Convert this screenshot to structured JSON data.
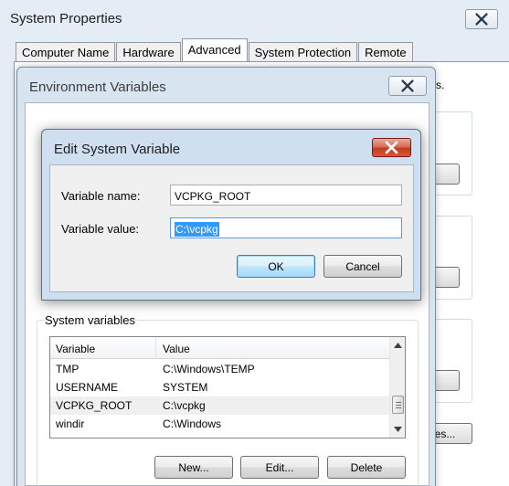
{
  "system_properties": {
    "title": "System Properties",
    "tabs": [
      {
        "label": "Computer Name"
      },
      {
        "label": "Hardware"
      },
      {
        "label": "Advanced"
      },
      {
        "label": "System Protection"
      },
      {
        "label": "Remote"
      }
    ],
    "active_tab": "Advanced",
    "edge_text": "s.",
    "edge_buttons": [
      "...",
      "...",
      "...",
      "les..."
    ]
  },
  "environment_variables": {
    "title": "Environment Variables",
    "system_vars_label": "System variables",
    "columns": [
      "Variable",
      "Value"
    ],
    "rows": [
      {
        "variable": "TMP",
        "value": "C:\\Windows\\TEMP"
      },
      {
        "variable": "USERNAME",
        "value": "SYSTEM"
      },
      {
        "variable": "VCPKG_ROOT",
        "value": "C:\\vcpkg"
      },
      {
        "variable": "windir",
        "value": "C:\\Windows"
      }
    ],
    "buttons": {
      "new": "New...",
      "edit": "Edit...",
      "delete": "Delete"
    }
  },
  "edit_dialog": {
    "title": "Edit System Variable",
    "name_label": "Variable name:",
    "name_value": "VCPKG_ROOT",
    "value_label": "Variable value:",
    "value_value": "C:\\vcpkg",
    "ok": "OK",
    "cancel": "Cancel"
  }
}
